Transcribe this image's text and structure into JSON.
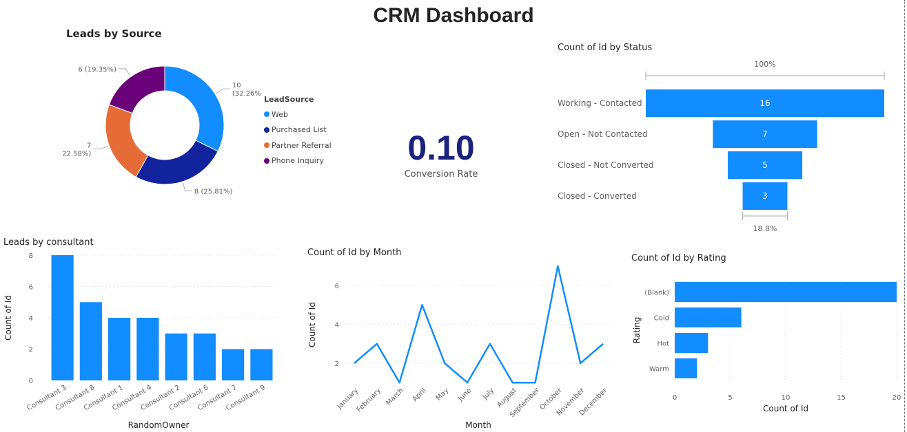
{
  "page": {
    "title": "CRM Dashboard"
  },
  "kpi": {
    "value": "0.10",
    "label": "Conversion Rate"
  },
  "chart_data": [
    {
      "id": "leads-by-source",
      "type": "pie",
      "title": "Leads by Source",
      "legend_title": "LeadSource",
      "legend_position": "right",
      "categories": [
        "Web",
        "Purchased List",
        "Partner Referral",
        "Phone Inquiry"
      ],
      "values": [
        10,
        8,
        7,
        6
      ],
      "labels": [
        "10 (32.26%)",
        "8 (25.81%)",
        "7 (22.58%)",
        "6 (19.35%)"
      ],
      "colors": [
        "#118DFF",
        "#12239E",
        "#E66C37",
        "#6B007B"
      ]
    },
    {
      "id": "count-by-status",
      "type": "bar",
      "title": "Count of Id by Status",
      "categories": [
        "Working - Contacted",
        "Open - Not Contacted",
        "Closed - Not Converted",
        "Closed - Converted"
      ],
      "values": [
        16,
        7,
        5,
        3
      ],
      "top_label": "100%",
      "bottom_label": "18.8%",
      "color": "#118DFF"
    },
    {
      "id": "leads-by-consultant",
      "type": "bar",
      "title": "Leads by consultant",
      "xlabel": "RandomOwner",
      "ylabel": "Count of Id",
      "categories": [
        "Consultant 3",
        "Consultant 8",
        "Consultant 1",
        "Consultant 4",
        "Consultant 2",
        "Consultant 6",
        "Consultant 7",
        "Consultant 9"
      ],
      "values": [
        8,
        5,
        4,
        4,
        3,
        3,
        2,
        2
      ],
      "ylim": [
        0,
        8
      ],
      "yticks": [
        0,
        2,
        4,
        6,
        8
      ],
      "grid": true,
      "color": "#118DFF"
    },
    {
      "id": "count-by-month",
      "type": "line",
      "title": "Count of Id by Month",
      "xlabel": "Month",
      "ylabel": "Count of Id",
      "categories": [
        "January",
        "February",
        "March",
        "April",
        "May",
        "June",
        "July",
        "August",
        "September",
        "October",
        "November",
        "December"
      ],
      "values": [
        2,
        3,
        1,
        5,
        2,
        1,
        3,
        1,
        1,
        7,
        2,
        3
      ],
      "yticks": [
        2,
        4,
        6
      ],
      "grid": true,
      "color": "#118DFF"
    },
    {
      "id": "count-by-rating",
      "type": "bar",
      "title": "Count of Id by Rating",
      "xlabel": "Count of Id",
      "ylabel": "Rating",
      "categories": [
        "(Blank)",
        "Cold",
        "Hot",
        "Warm"
      ],
      "values": [
        20,
        6,
        3,
        2
      ],
      "xlim": [
        0,
        20
      ],
      "xticks": [
        0,
        5,
        10,
        15,
        20
      ],
      "grid": true,
      "color": "#118DFF"
    }
  ]
}
